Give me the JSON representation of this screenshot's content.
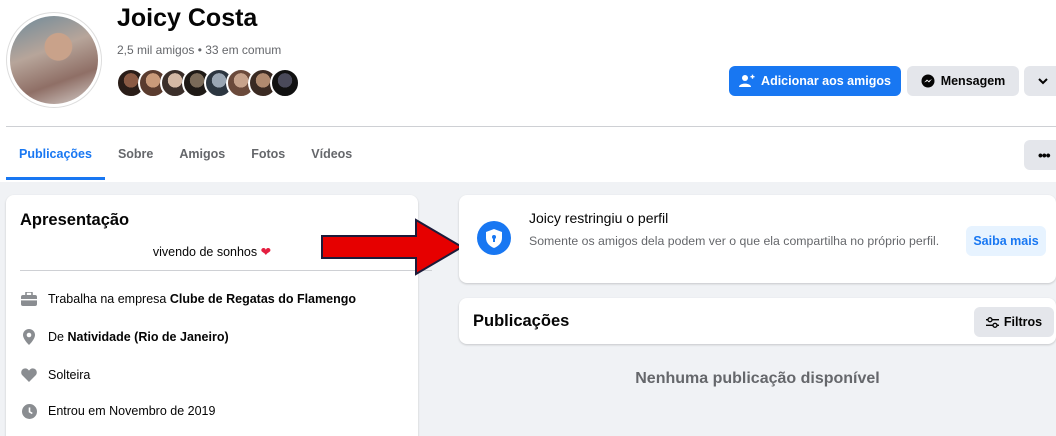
{
  "profile": {
    "name": "Joicy Costa",
    "friends_meta": "2,5 mil amigos • 33 em comum"
  },
  "actions": {
    "add_friend": "Adicionar aos amigos",
    "message": "Mensagem"
  },
  "tabs": [
    {
      "label": "Publicações",
      "active": true
    },
    {
      "label": "Sobre"
    },
    {
      "label": "Amigos"
    },
    {
      "label": "Fotos"
    },
    {
      "label": "Vídeos"
    }
  ],
  "intro": {
    "title": "Apresentação",
    "bio": "vivendo de sonhos",
    "work_prefix": "Trabalha na empresa ",
    "work_place": "Clube de Regatas do Flamengo",
    "from_prefix": "De ",
    "from_place": "Natividade (Rio de Janeiro)",
    "relationship": "Solteira",
    "joined": "Entrou em Novembro de 2019"
  },
  "restricted": {
    "title": "Joicy restringiu o perfil",
    "text": "Somente os amigos dela podem ver o que ela compartilha no próprio perfil.",
    "button": "Saiba mais"
  },
  "posts": {
    "title": "Publicações",
    "filter": "Filtros",
    "empty": "Nenhuma publicação disponível"
  },
  "colors": {
    "brand": "#1877f2",
    "arrow": "#e60000",
    "heart": "#e41e3f"
  },
  "icons": [
    "add-friend-icon",
    "messenger-icon",
    "chevron-down-icon",
    "more-dots-icon",
    "briefcase-icon",
    "location-pin-icon",
    "heart-icon",
    "clock-icon",
    "shield-icon",
    "filter-icon"
  ]
}
